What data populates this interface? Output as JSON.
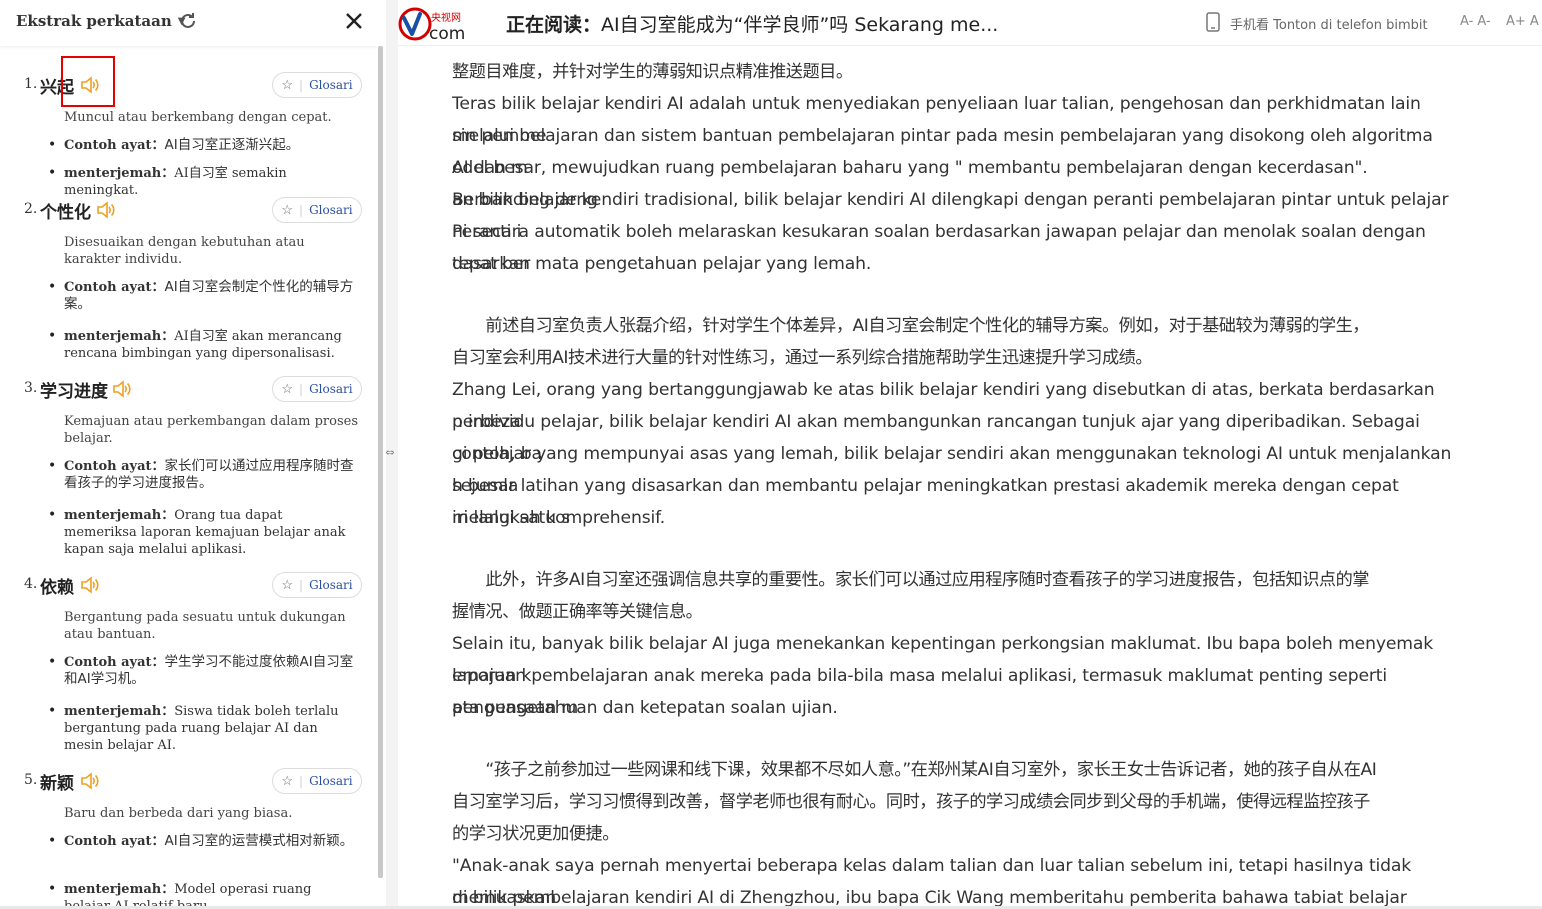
{
  "sidebar": {
    "title": "Ekstrak perkataan",
    "glosari_label": "Glosari",
    "example_label": "Contoh ayat",
    "translator_label": "menterjemah",
    "entries": [
      {
        "num": "1.",
        "word": "兴起",
        "definition": "Muncul atau berkembang dengan cepat.",
        "example": "AI自习室正逐渐兴起。",
        "translation": "AI自习室 semakin meningkat."
      },
      {
        "num": "2.",
        "word": "个性化",
        "definition": "Disesuaikan dengan kebutuhan atau karakter individu.",
        "example": "AI自习室会制定个性化的辅导方案。",
        "translation": "AI自习室 akan merancang rencana bimbingan yang dipersonalisasi."
      },
      {
        "num": "3.",
        "word": "学习进度",
        "definition": "Kemajuan atau perkembangan dalam proses belajar.",
        "example": "家长们可以通过应用程序随时查看孩子的学习进度报告。",
        "translation": "Orang tua dapat memeriksa laporan kemajuan belajar anak kapan saja melalui aplikasi."
      },
      {
        "num": "4.",
        "word": "依赖",
        "definition": "Bergantung pada sesuatu untuk dukungan atau bantuan.",
        "example": "学生学习不能过度依赖AI自习室和AI学习机。",
        "translation": "Siswa tidak boleh terlalu bergantung pada ruang belajar AI dan mesin belajar AI."
      },
      {
        "num": "5.",
        "word": "新颖",
        "definition": "Baru dan berbeda dari yang biasa.",
        "example": "AI自习室的运营模式相对新颖。",
        "translation": "Model operasi ruang belajar AI relatif baru."
      }
    ]
  },
  "topbar": {
    "logo_cn": "央视网",
    "logo_com": "com",
    "reading_label": "正在阅读：",
    "reading_title": "AI自习室能成为“伴学良师”吗 Sekarang me...",
    "phone_label": "手机看 Tonton di telefon bimbit",
    "font_smaller": "A- A-",
    "font_larger": "A+ A"
  },
  "article": {
    "paragraphs": [
      "整题目难度，并针对学生的薄弱知识点精准推送题目。",
      "Teras bilik belajar kendiri AI adalah untuk menyediakan penyeliaan luar talian, pengehosan dan perkhidmatan lain melalui me",
      "sin pembelajaran dan sistem bantuan pembelajaran pintar pada mesin pembelajaran yang disokong oleh algoritma AI dan m",
      "odel besar, mewujudkan ruang pembelajaran baharu yang \" membantu pembelajaran dengan kecerdasan\". Berbanding deng",
      "an bilik belajar kendiri tradisional, bilik belajar kendiri AI dilengkapi dengan peranti pembelajaran pintar untuk pelajar Peranti i",
      "ni secara automatik boleh melaraskan kesukaran soalan berdasarkan jawapan pelajar dan menolak soalan dengan tepat ber",
      "dasarkan mata pengetahuan pelajar yang lemah.",
      "　　前述自习室负责人张磊介绍，针对学生个体差异，AI自习室会制定个性化的辅导方案。例如，对于基础较为薄弱的学生，",
      "自习室会利用AI技术进行大量的针对性练习，通过一系列综合措施帮助学生迅速提升学习成绩。",
      "Zhang Lei, orang yang bertanggungjawab ke atas bilik belajar kendiri yang disebutkan di atas, berkata berdasarkan perbeza",
      "n individu pelajar, bilik belajar kendiri AI akan membangunkan rancangan tunjuk ajar yang diperibadikan. Sebagai contoh, ba",
      "gi pelajar yang mempunyai asas yang lemah, bilik belajar sendiri akan menggunakan teknologi AI untuk menjalankan sejumla",
      "h besar latihan yang disasarkan dan membantu pelajar meningkatkan prestasi akademik mereka dengan cepat melalui satu s",
      "iri langkah komprehensif.",
      "　　此外，许多AI自习室还强调信息共享的重要性。家长们可以通过应用程序随时查看孩子的学习进度报告，包括知识点的掌",
      "握情况、做题正确率等关键信息。",
      "Selain itu, banyak bilik belajar AI juga menekankan kepentingan perkongsian maklumat. Ibu bapa boleh menyemak laporan k",
      "emajuan pembelajaran anak mereka pada bila-bila masa melalui aplikasi, termasuk maklumat penting seperti penguasaan m",
      "ata pengetahuan dan ketepatan soalan ujian.",
      "　　“孩子之前参加过一些网课和线下课，效果都不尽如人意。”在郑州某AI自习室外，家长王女士告诉记者，她的孩子自从在AI",
      "自习室学习后，学习习惯得到改善，督学老师也很有耐心。同时，孩子的学习成绩会同步到父母的手机端，使得远程监控孩子",
      "的学习状况更加便捷。",
      "\"Anak-anak saya pernah menyertai beberapa kelas dalam talian dan luar talian sebelum ini, tetapi hasilnya tidak memuaskan",
      "di bilik pembelajaran kendiri AI di Zhengzhou, ibu bapa Cik Wang memberitahu pemberita bahawa tabiat belajar anak-anakny"
    ]
  },
  "colors": {
    "speaker": "#f0a020",
    "highlight": "#e60000",
    "glosari_text": "#2b4fa0",
    "cctv_red": "#d40000",
    "cctv_blue": "#1a4fa8"
  }
}
